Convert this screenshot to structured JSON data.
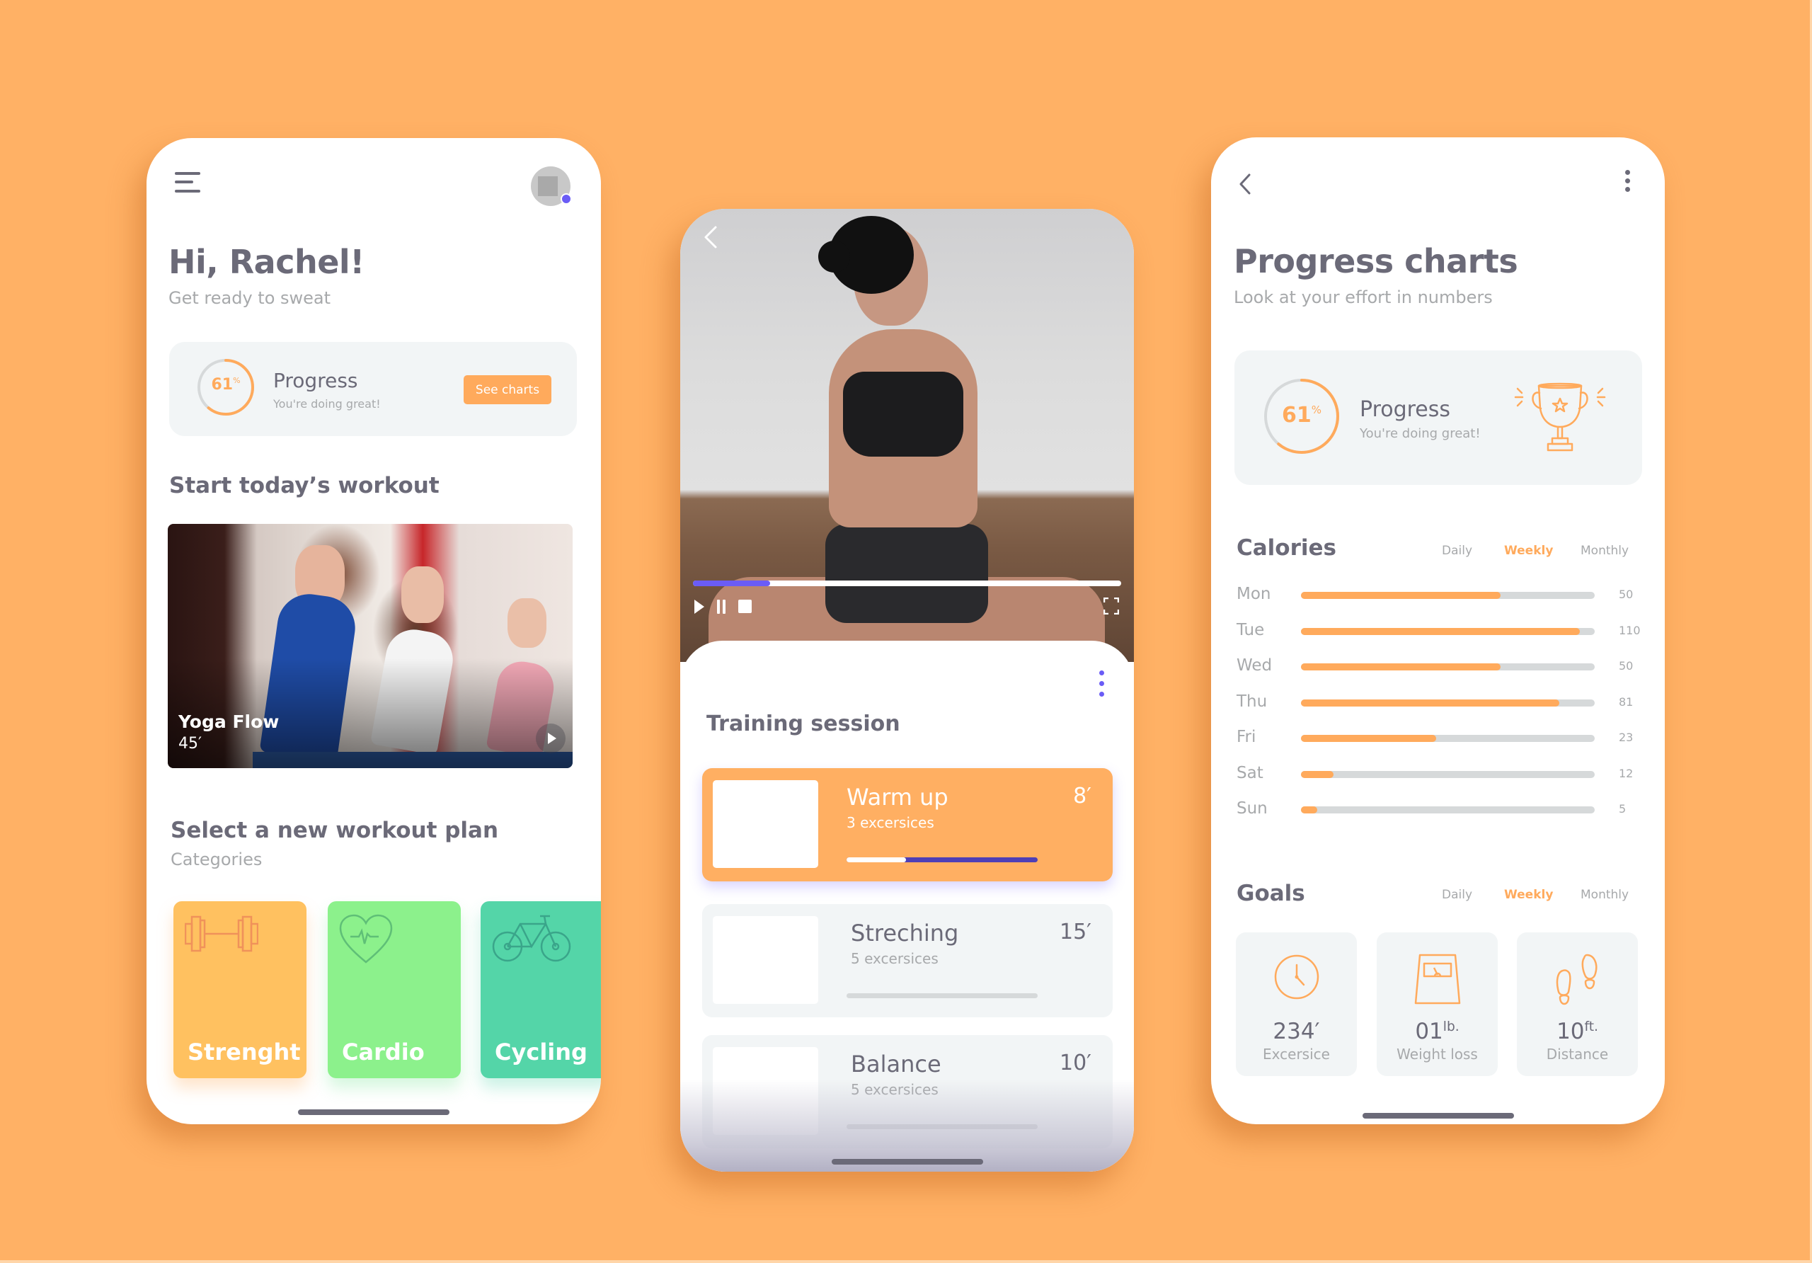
{
  "colors": {
    "background": "#FFB165",
    "accent_orange": "#FFAA5C",
    "accent_purple": "#6A5CF6",
    "text_dark": "#6B6A78",
    "text_grey": "#A7A9AB",
    "card_bg": "#F2F5F6",
    "category_strength": "#FFC160",
    "category_cardio": "#8CF18C",
    "category_cycling": "#54D5A8"
  },
  "home": {
    "menu_icon": "hamburger-menu-icon",
    "greeting": "Hi, Rachel!",
    "subtitle": "Get ready to sweat",
    "progress": {
      "percent_value": 61,
      "percent_number": "61",
      "percent_sign": "%",
      "title": "Progress",
      "message": "You're doing great!",
      "button_label": "See charts"
    },
    "today_heading": "Start today’s workout",
    "featured_workout": {
      "title": "Yoga Flow",
      "duration": "45′"
    },
    "plan_heading": "Select a new workout plan",
    "plan_subheading": "Categories",
    "categories": [
      {
        "label": "Strenght",
        "icon": "dumbbell-icon"
      },
      {
        "label": "Cardio",
        "icon": "heart-pulse-icon"
      },
      {
        "label": "Cycling",
        "icon": "bicycle-icon"
      }
    ]
  },
  "session": {
    "video_progress": 0.18,
    "controls": [
      "play-icon",
      "pause-icon",
      "stop-icon",
      "fullscreen-icon"
    ],
    "title": "Training session",
    "items": [
      {
        "name": "Warm up",
        "count": "3 excersices",
        "duration": "8′",
        "progress": 0.31,
        "active": true
      },
      {
        "name": "Streching",
        "count": "5 excersices",
        "duration": "15′",
        "progress": 0,
        "active": false
      },
      {
        "name": "Balance",
        "count": "5 excersices",
        "duration": "10′",
        "progress": 0,
        "active": false
      }
    ]
  },
  "charts": {
    "title": "Progress charts",
    "subtitle": "Look at your effort in numbers",
    "progress": {
      "percent_value": 61,
      "percent_number": "61",
      "percent_sign": "%",
      "title": "Progress",
      "message": "You're doing great!",
      "icon": "trophy-icon"
    },
    "calories": {
      "heading": "Calories",
      "tabs": [
        "Daily",
        "Weekly",
        "Monthly"
      ],
      "active_tab": "Weekly"
    },
    "goals": {
      "heading": "Goals",
      "tabs": [
        "Daily",
        "Weekly",
        "Monthly"
      ],
      "active_tab": "Weekly",
      "items": [
        {
          "value": "234′",
          "unit": "",
          "label": "Excersice",
          "icon": "clock-icon"
        },
        {
          "value": "01",
          "unit": "lb.",
          "label": "Weight loss",
          "icon": "scale-icon"
        },
        {
          "value": "10",
          "unit": "ft.",
          "label": "Distance",
          "icon": "footsteps-icon"
        }
      ]
    }
  },
  "chart_data": {
    "type": "bar",
    "orientation": "horizontal",
    "title": "Calories",
    "categories": [
      "Mon",
      "Tue",
      "Wed",
      "Thu",
      "Fri",
      "Sat",
      "Sun"
    ],
    "values": [
      50,
      110,
      50,
      81,
      23,
      12,
      5
    ],
    "fill_fraction": [
      0.68,
      0.95,
      0.68,
      0.88,
      0.46,
      0.11,
      0.055
    ],
    "xlabel": "",
    "ylabel": "",
    "grid": false,
    "legend": "none"
  }
}
